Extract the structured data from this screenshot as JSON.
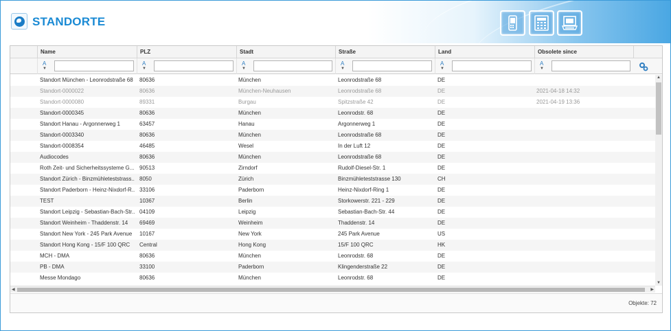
{
  "header": {
    "title": "STANDORTE"
  },
  "grid": {
    "columns": [
      {
        "key": "name",
        "label": "Name"
      },
      {
        "key": "plz",
        "label": "PLZ"
      },
      {
        "key": "stadt",
        "label": "Stadt"
      },
      {
        "key": "strasse",
        "label": "Straße"
      },
      {
        "key": "land",
        "label": "Land"
      },
      {
        "key": "obsolete",
        "label": "Obsolete since"
      }
    ],
    "filter_sort_glyph": "A",
    "rows": [
      {
        "name": "Standort München - Leonrodstraße 68",
        "plz": "80636",
        "stadt": "München",
        "strasse": "Leonrodstraße 68",
        "land": "DE",
        "obsolete": ""
      },
      {
        "name": "Standort-0000022",
        "plz": "80636",
        "stadt": "München-Neuhausen",
        "strasse": "Leonrodstraße 68",
        "land": "DE",
        "obsolete": "2021-04-18 14:32"
      },
      {
        "name": "Standort-0000080",
        "plz": "89331",
        "stadt": "Burgau",
        "strasse": "Spitzstraße 42",
        "land": "DE",
        "obsolete": "2021-04-19 13:36"
      },
      {
        "name": "Standort-0000345",
        "plz": "80636",
        "stadt": "München",
        "strasse": "Leonrodstr. 68",
        "land": "DE",
        "obsolete": ""
      },
      {
        "name": "Standort Hanau - Argonnerweg 1",
        "plz": "63457",
        "stadt": "Hanau",
        "strasse": "Argonnerweg 1",
        "land": "DE",
        "obsolete": ""
      },
      {
        "name": "Standort-0003340",
        "plz": "80636",
        "stadt": "München",
        "strasse": "Leonrodstraße 68",
        "land": "DE",
        "obsolete": ""
      },
      {
        "name": "Standort-0008354",
        "plz": "46485",
        "stadt": "Wesel",
        "strasse": "In der Luft 12",
        "land": "DE",
        "obsolete": ""
      },
      {
        "name": "Audiocodes",
        "plz": "80636",
        "stadt": "München",
        "strasse": "Leonrodstraße 68",
        "land": "DE",
        "obsolete": ""
      },
      {
        "name": "Roth Zeit- und Sicherheitssysteme G...",
        "plz": "90513",
        "stadt": "Zirndorf",
        "strasse": "Rudolf-Diesel-Str. 1",
        "land": "DE",
        "obsolete": ""
      },
      {
        "name": "Standort Zürich - Binzmühleteststrass...",
        "plz": "8050",
        "stadt": "Zürich",
        "strasse": "Binzmühleteststrasse 130",
        "land": "CH",
        "obsolete": ""
      },
      {
        "name": "Standort Paderborn - Heinz-Nixdorf-R...",
        "plz": "33106",
        "stadt": "Paderborn",
        "strasse": "Heinz-Nixdorf-Ring 1",
        "land": "DE",
        "obsolete": ""
      },
      {
        "name": "TEST",
        "plz": "10367",
        "stadt": "Berlin",
        "strasse": "Storkowerstr. 221 - 229",
        "land": "DE",
        "obsolete": ""
      },
      {
        "name": "Standort Leipzig - Sebastian-Bach-Str...",
        "plz": "04109",
        "stadt": "Leipzig",
        "strasse": "Sebastian-Bach-Str. 44",
        "land": "DE",
        "obsolete": ""
      },
      {
        "name": "Standort Weinheim - Thaddenstr. 14",
        "plz": "69469",
        "stadt": "Weinheim",
        "strasse": "Thaddenstr. 14",
        "land": "DE",
        "obsolete": ""
      },
      {
        "name": "Standort New York - 245 Park Avenue",
        "plz": "10167",
        "stadt": "New York",
        "strasse": "245 Park Avenue",
        "land": "US",
        "obsolete": ""
      },
      {
        "name": "Standort Hong Kong - 15/F 100 QRC",
        "plz": "Central",
        "stadt": "Hong Kong",
        "strasse": "15/F 100 QRC",
        "land": "HK",
        "obsolete": ""
      },
      {
        "name": "MCH - DMA",
        "plz": "80636",
        "stadt": "München",
        "strasse": "Leonrodstr. 68",
        "land": "DE",
        "obsolete": ""
      },
      {
        "name": "PB - DMA",
        "plz": "33100",
        "stadt": "Paderborn",
        "strasse": "Klingenderstraße 22",
        "land": "DE",
        "obsolete": ""
      },
      {
        "name": "Messe Mondago",
        "plz": "80636",
        "stadt": "München",
        "strasse": "Leonrodstr. 68",
        "land": "DE",
        "obsolete": ""
      }
    ],
    "obsolete_rows": [
      1,
      2
    ]
  },
  "footer": {
    "count_label": "Objekte: 72"
  },
  "icons": [
    "globe-icon",
    "mobile-phone-icon",
    "desk-phone-icon",
    "conference-phone-icon",
    "column-settings-icon",
    "sort-filter-icon"
  ],
  "colors": {
    "accent": "#1a8ad4",
    "border": "#3a9ad9",
    "muted_text": "#999999"
  }
}
